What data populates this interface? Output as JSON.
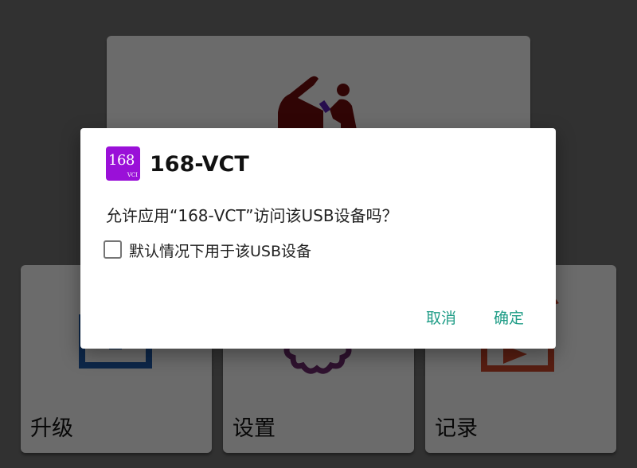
{
  "cards": {
    "upgrade_label": "升级",
    "settings_label": "设置",
    "records_label": "记录"
  },
  "dialog": {
    "app_icon_text": "168",
    "app_icon_subtext": "VCI",
    "title": "168-VCT",
    "message": "允许应用“168-VCT”访问该USB设备吗？",
    "checkbox_label": "默认情况下用于该USB设备",
    "checkbox_checked": false,
    "cancel_label": "取消",
    "ok_label": "确定"
  },
  "colors": {
    "accent": "#1e9c86",
    "app_icon": "#9a10d8",
    "car_icon": "#6f0d0d",
    "upgrade_icon": "#1f5aa6",
    "settings_icon": "#6b2a6b",
    "records_icon": "#c8442a"
  },
  "icons": {
    "top_card": "car-repair-icon",
    "upgrade": "upgrade-icon",
    "settings": "gear-icon",
    "records": "records-icon"
  }
}
